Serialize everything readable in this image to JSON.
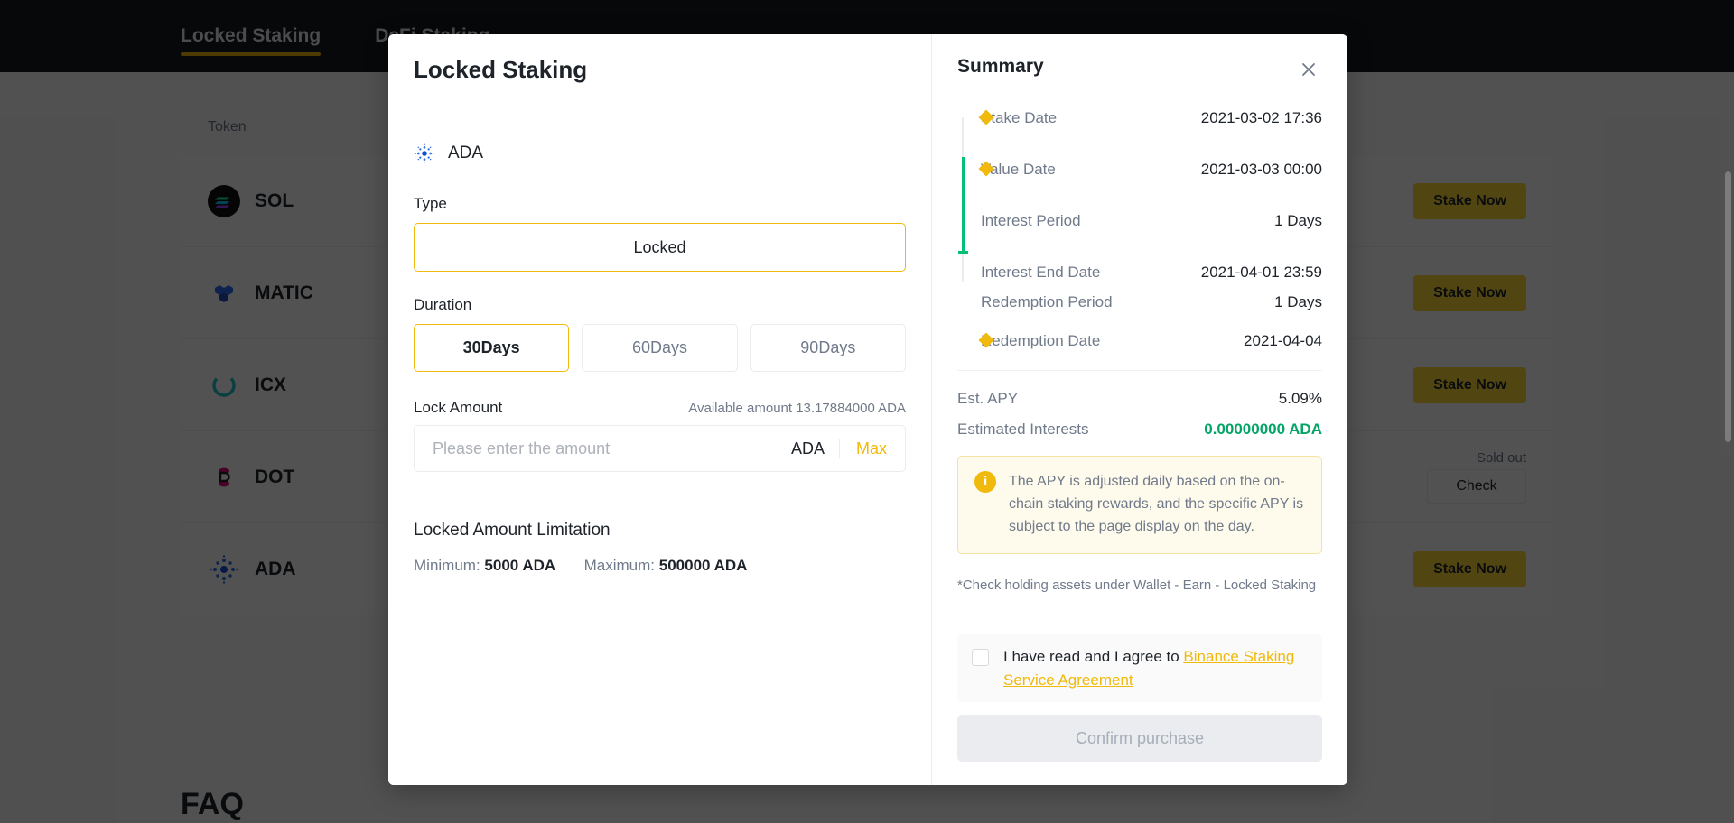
{
  "background": {
    "tabs": [
      {
        "label": "Locked Staking",
        "active": true
      },
      {
        "label": "DeFi Staking",
        "active": false
      }
    ],
    "table_header": "Token",
    "rows": [
      {
        "coin": "SOL",
        "icon": "sol-icon",
        "action": "Stake Now",
        "status": ""
      },
      {
        "coin": "MATIC",
        "icon": "matic-icon",
        "action": "Stake Now",
        "status": ""
      },
      {
        "coin": "ICX",
        "icon": "icx-icon",
        "action": "Stake Now",
        "status": ""
      },
      {
        "coin": "DOT",
        "icon": "dot-icon",
        "action": "Check",
        "status": "Sold out"
      },
      {
        "coin": "ADA",
        "icon": "ada-icon",
        "action": "Stake Now",
        "status": ""
      }
    ],
    "faq": "FAQ"
  },
  "modal": {
    "title": "Locked Staking",
    "coin": {
      "icon": "ada-icon",
      "label": "ADA"
    },
    "type": {
      "label": "Type",
      "value": "Locked"
    },
    "duration": {
      "label": "Duration",
      "options": [
        {
          "label": "30Days",
          "selected": true
        },
        {
          "label": "60Days",
          "selected": false
        },
        {
          "label": "90Days",
          "selected": false
        }
      ]
    },
    "lock_amount": {
      "label": "Lock Amount",
      "available": "Available amount 13.17884000 ADA",
      "placeholder": "Please enter the amount",
      "value": "",
      "unit": "ADA",
      "max_label": "Max"
    },
    "limitation": {
      "title": "Locked Amount Limitation",
      "minimum_label": "Minimum:",
      "minimum_value": "5000 ADA",
      "maximum_label": "Maximum:",
      "maximum_value": "500000 ADA"
    },
    "summary": {
      "title": "Summary",
      "close_icon": "close-icon",
      "timeline": [
        {
          "label": "Stake Date",
          "value": "2021-03-02 17:36",
          "marker": "diamond"
        },
        {
          "label": "Value Date",
          "value": "2021-03-03 00:00",
          "marker": "diamond"
        },
        {
          "label": "Interest Period",
          "value": "1 Days",
          "marker": "none"
        },
        {
          "label": "Interest End Date",
          "value": "2021-04-01 23:59",
          "marker": "cap"
        },
        {
          "label": "Redemption Period",
          "value": "1 Days",
          "marker": "none"
        },
        {
          "label": "Redemption Date",
          "value": "2021-04-04",
          "marker": "diamond"
        }
      ],
      "apy_label": "Est. APY",
      "apy_value": "5.09%",
      "interests_label": "Estimated Interests",
      "interests_value": "0.00000000 ADA",
      "notice_icon": "info-icon",
      "notice_text": "The APY is adjusted daily based on the on-chain staking rewards, and the specific APY is subject to the page display on the day.",
      "footnote": "*Check holding assets under Wallet - Earn - Locked Staking",
      "agree_prefix": "I have read and I agree to ",
      "agree_link": "Binance Staking Service Agreement",
      "agree_checked": false,
      "confirm_label": "Confirm purchase"
    }
  },
  "colors": {
    "brand": "#f0b90b",
    "brand_button": "#fcd535",
    "dark": "#181a20",
    "text": "#1e2329",
    "muted": "#707a8a",
    "green": "#02c076",
    "notice_bg": "#fefaec",
    "notice_border": "#f5e3a4"
  }
}
